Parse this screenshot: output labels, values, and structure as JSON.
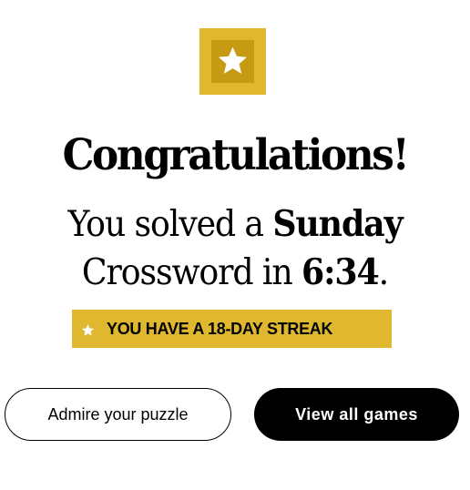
{
  "badge": {
    "icon": "star-icon"
  },
  "headline": "Congratulations!",
  "message": {
    "line1_prefix": "You solved a ",
    "line1_bold": "Sunday",
    "line2_prefix": "Crossword in ",
    "line2_bold": "6:34",
    "line2_suffix": "."
  },
  "streak": {
    "icon": "star-icon",
    "text": "YOU HAVE A 18-DAY STREAK"
  },
  "buttons": {
    "admire_label": "Admire your puzzle",
    "view_all_label": "View all games"
  },
  "colors": {
    "gold": "#e0b830",
    "gold_dark": "#c79a14",
    "black": "#000000",
    "white": "#ffffff"
  }
}
